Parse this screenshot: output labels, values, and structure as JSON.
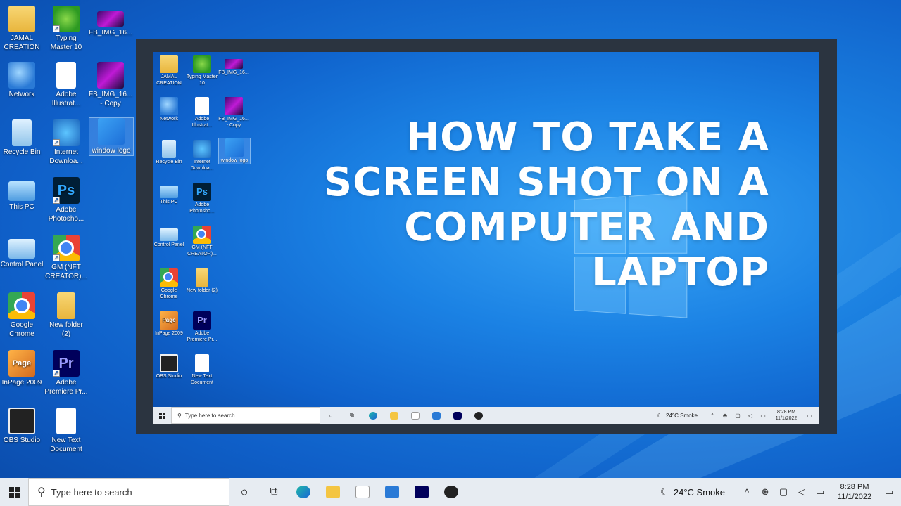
{
  "desktop_icons": [
    {
      "label": "JAMAL CREATION",
      "icon": "folder-icon"
    },
    {
      "label": "Typing Master 10",
      "icon": "typing-master-icon"
    },
    {
      "label": "FB_IMG_16...",
      "icon": "image-file-icon"
    },
    {
      "label": "Network",
      "icon": "network-icon"
    },
    {
      "label": "Adobe Illustrat...",
      "icon": "document-icon"
    },
    {
      "label": "FB_IMG_16... - Copy",
      "icon": "image-file-icon"
    },
    {
      "label": "Recycle Bin",
      "icon": "recycle-bin-icon"
    },
    {
      "label": "Internet Downloa...",
      "icon": "idm-icon"
    },
    {
      "label": "window logo",
      "icon": "windows-logo-file-icon"
    },
    {
      "label": "This PC",
      "icon": "computer-icon"
    },
    {
      "label": "Adobe Photosho...",
      "icon": "photoshop-icon"
    },
    {
      "label": "Control Panel",
      "icon": "control-panel-icon"
    },
    {
      "label": "GM (NFT CREATOR)...",
      "icon": "chrome-profile-icon"
    },
    {
      "label": "Google Chrome",
      "icon": "chrome-icon"
    },
    {
      "label": "New folder (2)",
      "icon": "folder-icon"
    },
    {
      "label": "InPage 2009",
      "icon": "inpage-icon"
    },
    {
      "label": "Adobe Premiere Pr...",
      "icon": "premiere-icon"
    },
    {
      "label": "OBS Studio",
      "icon": "obs-icon"
    },
    {
      "label": "New Text Document",
      "icon": "text-document-icon"
    }
  ],
  "mini_icons": {
    "jamal": "JAMAL CREATION",
    "typing": "Typing Master 10",
    "fbimg": "FB_IMG_16...",
    "network": "Network",
    "illustrator": "Adobe Illustrat...",
    "fbcopy": "FB_IMG_16... - Copy",
    "recycle": "Recycle Bin",
    "idm": "Internet Downloa...",
    "windowlogo": "window logo",
    "thispc": "This PC",
    "photoshop": "Adobe Photosho...",
    "cpanel": "Control Panel",
    "gm": "GM (NFT CREATOR)...",
    "chrome": "Google Chrome",
    "newfolder": "New folder (2)",
    "inpage": "InPage 2009",
    "premiere": "Adobe Premiere Pr...",
    "obs": "OBS Studio",
    "newtext": "New Text Document"
  },
  "headline": [
    "HOW TO TAKE A",
    "SCREEN SHOT ON A",
    "COMPUTER AND",
    "LAPTOP"
  ],
  "taskbar": {
    "search_placeholder": "Type here to search",
    "weather": "24°C  Smoke",
    "time": "8:28 PM",
    "date": "11/1/2022"
  },
  "mini_taskbar": {
    "search_placeholder": "Type here to search",
    "weather": "24°C  Smoke",
    "time": "8:28 PM",
    "date": "11/1/2022"
  },
  "colors": {
    "desktop_blue": "#1a7fe0",
    "frame": "#2b3440",
    "taskbar": "#e7ecf2"
  }
}
